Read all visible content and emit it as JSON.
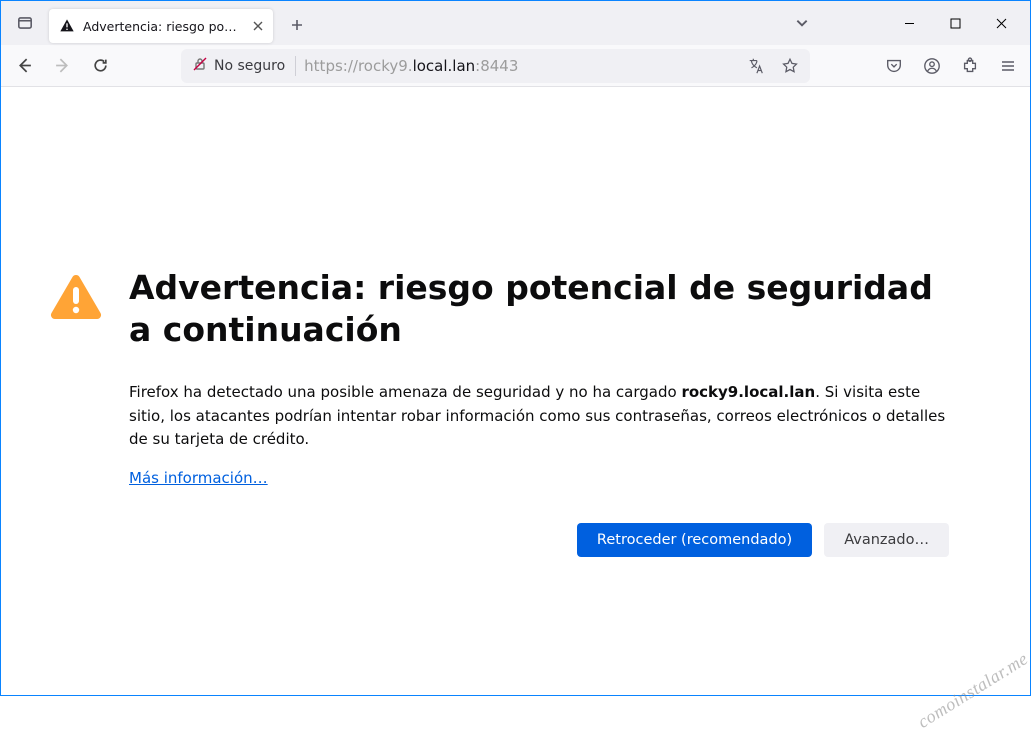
{
  "tab": {
    "title": "Advertencia: riesgo potencial de"
  },
  "urlbar": {
    "identity_label": "No seguro",
    "url_scheme": "https://",
    "url_sub": "rocky9.",
    "url_domain": "local.lan",
    "url_port": ":8443"
  },
  "page": {
    "heading": "Advertencia: riesgo potencial de seguridad a continuación",
    "desc_pre": "Firefox ha detectado una posible amenaza de seguridad y no ha cargado ",
    "desc_bold": "rocky9.local.lan",
    "desc_post": ". Si visita este sitio, los atacantes podrían intentar robar información como sus contraseñas, correos electrónicos o detalles de su tarjeta de crédito.",
    "more_info": "Más información…",
    "btn_back": "Retroceder (recomendado)",
    "btn_advanced": "Avanzado…"
  },
  "watermark": "comoinstalar.me"
}
